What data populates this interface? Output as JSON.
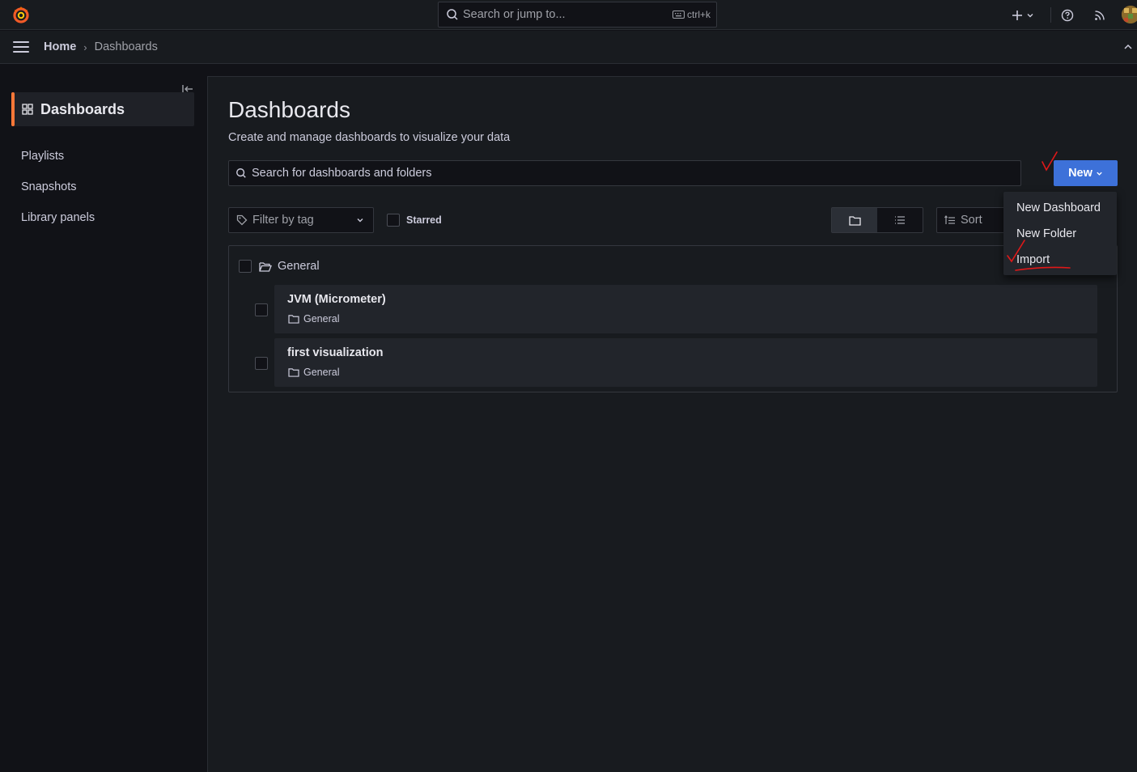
{
  "topbar": {
    "logo": "grafana-logo",
    "search_placeholder": "Search or jump to...",
    "shortcut": "ctrl+k",
    "icons": [
      "plus-icon",
      "chevron-down-icon",
      "help-icon",
      "rss-icon",
      "avatar"
    ]
  },
  "breadcrumb": {
    "home": "Home",
    "separator": "›",
    "current": "Dashboards"
  },
  "sidebar": {
    "active": {
      "label": "Dashboards",
      "icon": "apps-icon"
    },
    "items": [
      {
        "label": "Playlists"
      },
      {
        "label": "Snapshots"
      },
      {
        "label": "Library panels"
      }
    ],
    "accent": "#ff7838"
  },
  "page": {
    "title": "Dashboards",
    "subtitle": "Create and manage dashboards to visualize your data",
    "search_placeholder": "Search for dashboards and folders",
    "new_button": "New",
    "filter_tag": "Filter by tag",
    "starred": "Starred",
    "sort": "Sort",
    "primary_color": "#3d71d9"
  },
  "results": {
    "folder": {
      "name": "General"
    },
    "dashboards": [
      {
        "title": "JVM (Micrometer)",
        "location": "General"
      },
      {
        "title": "first visualization",
        "location": "General"
      }
    ]
  },
  "new_menu": {
    "items": [
      "New Dashboard",
      "New Folder",
      "Import"
    ]
  },
  "annotation_color": "#e01818"
}
